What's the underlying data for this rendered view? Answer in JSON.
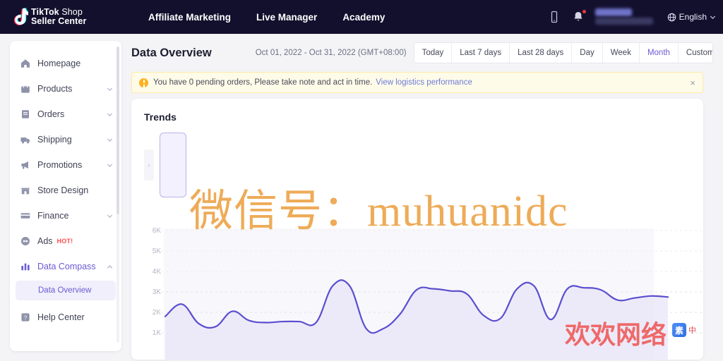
{
  "header": {
    "logo": {
      "line1_bold": "TikTok",
      "line1_regular": "Shop",
      "line2": "Seller Center",
      "icon": "tiktok-note-icon"
    },
    "nav": [
      {
        "label": "Affiliate Marketing"
      },
      {
        "label": "Live Manager"
      },
      {
        "label": "Academy"
      }
    ],
    "icons": [
      {
        "name": "mobile-app-icon"
      },
      {
        "name": "notification-bell-icon",
        "badge": true
      }
    ],
    "language": {
      "label": "English",
      "icon": "globe-icon",
      "chevron": "chevron-down-icon"
    }
  },
  "sidebar": {
    "items": [
      {
        "label": "Homepage",
        "icon": "home-icon",
        "expandable": false,
        "active": false
      },
      {
        "label": "Products",
        "icon": "bag-icon",
        "expandable": true,
        "active": false
      },
      {
        "label": "Orders",
        "icon": "clipboard-icon",
        "expandable": true,
        "active": false
      },
      {
        "label": "Shipping",
        "icon": "truck-icon",
        "expandable": true,
        "active": false
      },
      {
        "label": "Promotions",
        "icon": "megaphone-icon",
        "expandable": true,
        "active": false
      },
      {
        "label": "Store Design",
        "icon": "storefront-icon",
        "expandable": false,
        "active": false
      },
      {
        "label": "Finance",
        "icon": "card-icon",
        "expandable": true,
        "active": false
      },
      {
        "label": "Ads",
        "icon": "ads-icon",
        "expandable": false,
        "active": false,
        "badge": "HOT!"
      },
      {
        "label": "Data Compass",
        "icon": "bar-chart-icon",
        "expandable": true,
        "active": true,
        "expanded": true
      },
      {
        "label": "Help Center",
        "icon": "help-icon",
        "expandable": false,
        "active": false
      }
    ],
    "subitems": [
      {
        "parent": "Data Compass",
        "label": "Data Overview",
        "selected": true
      }
    ]
  },
  "main": {
    "title": "Data Overview",
    "date_range": "Oct 01, 2022 - Oct 31, 2022 (GMT+08:00)",
    "range_buttons": [
      {
        "label": "Today",
        "active": false
      },
      {
        "label": "Last 7 days",
        "active": false
      },
      {
        "label": "Last 28 days",
        "active": false
      },
      {
        "label": "Day",
        "active": false
      },
      {
        "label": "Week",
        "active": false
      },
      {
        "label": "Month",
        "active": true
      },
      {
        "label": "Custom",
        "active": false
      }
    ],
    "alert": {
      "icon": "warning-icon",
      "text": "You have 0 pending orders, Please take note and act in time.",
      "link": "View logistics performance",
      "close": "×"
    },
    "trends": {
      "title": "Trends",
      "scroll_left": "‹"
    }
  },
  "chart_data": {
    "type": "area",
    "title": "Trends",
    "xlabel": "",
    "ylabel": "",
    "grid": true,
    "legend_position": "none",
    "ylim": [
      0,
      6500
    ],
    "ytick_labels": [
      "6K",
      "5K",
      "4K",
      "3K",
      "2K",
      "1K"
    ],
    "ytick_values": [
      6000,
      5000,
      4000,
      3000,
      2000,
      1000
    ],
    "line_color": "#5a4fcf",
    "fill_color": "#e8e6f8",
    "series": [
      {
        "name": "Trend",
        "values": [
          1800,
          2400,
          1450,
          1300,
          2050,
          1600,
          1500,
          1550,
          1550,
          1500,
          3300,
          3300,
          1200,
          1200,
          1900,
          3100,
          3150,
          3050,
          2900,
          1850,
          1700,
          3150,
          3300,
          1650,
          3150,
          3200,
          3100,
          2600,
          2700,
          2800,
          2750
        ]
      }
    ]
  },
  "watermarks": {
    "wechat": "微信号：muhuanidc",
    "site": "欢欢网络",
    "ime_badge": "素",
    "ime_mode": "中"
  }
}
